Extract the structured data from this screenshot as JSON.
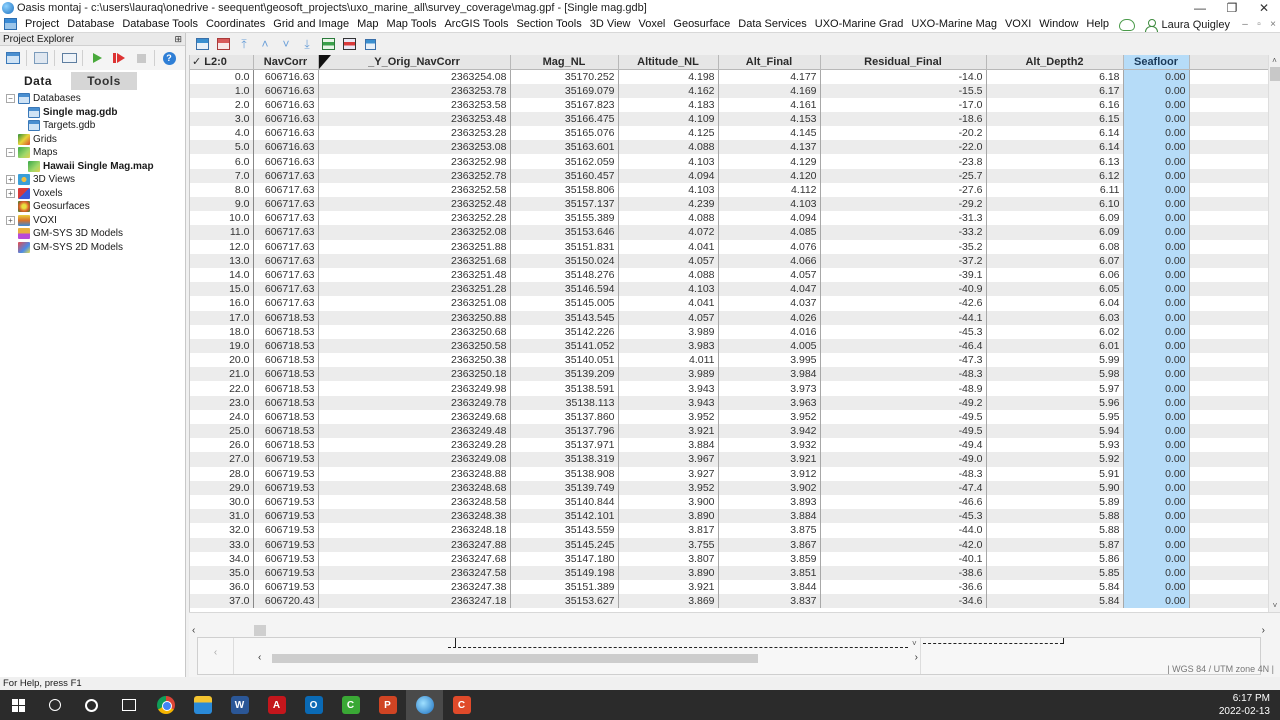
{
  "window": {
    "title": "Oasis montaj - c:\\users\\lauraq\\onedrive - seequent\\geosoft_projects\\uxo_marine_all\\survey_coverage\\mag.gpf - [Single mag.gdb]",
    "controls": {
      "minimize": "—",
      "restore": "❐",
      "close": "✕"
    }
  },
  "menubar": {
    "items": [
      "Project",
      "Database",
      "Database Tools",
      "Coordinates",
      "Grid and Image",
      "Map",
      "Map Tools",
      "ArcGIS Tools",
      "Section Tools",
      "3D View",
      "Voxel",
      "Geosurface",
      "Data Services",
      "UXO-Marine Grad",
      "UXO-Marine Mag",
      "VOXI",
      "Window",
      "Help"
    ],
    "user_name": "Laura Quigley",
    "mdi_controls": {
      "minimize": "–",
      "restore": "▫",
      "close": "×"
    }
  },
  "explorer": {
    "title": "Project Explorer",
    "pin": "⊞",
    "tabs": [
      {
        "label": "Data",
        "active": true
      },
      {
        "label": "Tools",
        "active": false
      }
    ],
    "tree": [
      {
        "label": "Databases",
        "expander": "−",
        "icon": "database-icon",
        "level": 0
      },
      {
        "label": "Single mag.gdb",
        "icon": "database-file-icon",
        "level": 1,
        "bold": true
      },
      {
        "label": "Targets.gdb",
        "icon": "database-file-icon",
        "level": 1
      },
      {
        "label": "Grids",
        "icon": "grid-icon",
        "level": 0
      },
      {
        "label": "Maps",
        "expander": "−",
        "icon": "map-icon",
        "level": 0
      },
      {
        "label": "Hawaii Single Mag.map",
        "icon": "map-file-icon",
        "level": 1,
        "bold": true
      },
      {
        "label": "3D Views",
        "expander": "+",
        "icon": "3d-view-icon",
        "level": 0
      },
      {
        "label": "Voxels",
        "expander": "+",
        "icon": "voxel-icon",
        "level": 0
      },
      {
        "label": "Geosurfaces",
        "icon": "geosurface-icon",
        "level": 0
      },
      {
        "label": "VOXI",
        "expander": "+",
        "icon": "voxi-icon",
        "level": 0
      },
      {
        "label": "GM-SYS 3D Models",
        "icon": "gmsys-3d-icon",
        "level": 0
      },
      {
        "label": "GM-SYS 2D Models",
        "icon": "gmsys-2d-icon",
        "level": 0
      }
    ]
  },
  "sheet": {
    "line_label": "✓ L2:0",
    "columns": [
      "NavCorr",
      "_Y_Orig_NavCorr",
      "Mag_NL",
      "Altitude_NL",
      "Alt_Final",
      "Residual_Final",
      "Alt_Depth2",
      "Seafloor"
    ],
    "selected_column": "Seafloor",
    "rows": [
      [
        "0.0",
        "606716.63",
        "2363254.08",
        "35170.252",
        "4.198",
        "4.177",
        "-14.0",
        "6.18",
        "0.00"
      ],
      [
        "1.0",
        "606716.63",
        "2363253.78",
        "35169.079",
        "4.162",
        "4.169",
        "-15.5",
        "6.17",
        "0.00"
      ],
      [
        "2.0",
        "606716.63",
        "2363253.58",
        "35167.823",
        "4.183",
        "4.161",
        "-17.0",
        "6.16",
        "0.00"
      ],
      [
        "3.0",
        "606716.63",
        "2363253.48",
        "35166.475",
        "4.109",
        "4.153",
        "-18.6",
        "6.15",
        "0.00"
      ],
      [
        "4.0",
        "606716.63",
        "2363253.28",
        "35165.076",
        "4.125",
        "4.145",
        "-20.2",
        "6.14",
        "0.00"
      ],
      [
        "5.0",
        "606716.63",
        "2363253.08",
        "35163.601",
        "4.088",
        "4.137",
        "-22.0",
        "6.14",
        "0.00"
      ],
      [
        "6.0",
        "606716.63",
        "2363252.98",
        "35162.059",
        "4.103",
        "4.129",
        "-23.8",
        "6.13",
        "0.00"
      ],
      [
        "7.0",
        "606717.63",
        "2363252.78",
        "35160.457",
        "4.094",
        "4.120",
        "-25.7",
        "6.12",
        "0.00"
      ],
      [
        "8.0",
        "606717.63",
        "2363252.58",
        "35158.806",
        "4.103",
        "4.112",
        "-27.6",
        "6.11",
        "0.00"
      ],
      [
        "9.0",
        "606717.63",
        "2363252.48",
        "35157.137",
        "4.239",
        "4.103",
        "-29.2",
        "6.10",
        "0.00"
      ],
      [
        "10.0",
        "606717.63",
        "2363252.28",
        "35155.389",
        "4.088",
        "4.094",
        "-31.3",
        "6.09",
        "0.00"
      ],
      [
        "11.0",
        "606717.63",
        "2363252.08",
        "35153.646",
        "4.072",
        "4.085",
        "-33.2",
        "6.09",
        "0.00"
      ],
      [
        "12.0",
        "606717.63",
        "2363251.88",
        "35151.831",
        "4.041",
        "4.076",
        "-35.2",
        "6.08",
        "0.00"
      ],
      [
        "13.0",
        "606717.63",
        "2363251.68",
        "35150.024",
        "4.057",
        "4.066",
        "-37.2",
        "6.07",
        "0.00"
      ],
      [
        "14.0",
        "606717.63",
        "2363251.48",
        "35148.276",
        "4.088",
        "4.057",
        "-39.1",
        "6.06",
        "0.00"
      ],
      [
        "15.0",
        "606717.63",
        "2363251.28",
        "35146.594",
        "4.103",
        "4.047",
        "-40.9",
        "6.05",
        "0.00"
      ],
      [
        "16.0",
        "606717.63",
        "2363251.08",
        "35145.005",
        "4.041",
        "4.037",
        "-42.6",
        "6.04",
        "0.00"
      ],
      [
        "17.0",
        "606718.53",
        "2363250.88",
        "35143.545",
        "4.057",
        "4.026",
        "-44.1",
        "6.03",
        "0.00"
      ],
      [
        "18.0",
        "606718.53",
        "2363250.68",
        "35142.226",
        "3.989",
        "4.016",
        "-45.3",
        "6.02",
        "0.00"
      ],
      [
        "19.0",
        "606718.53",
        "2363250.58",
        "35141.052",
        "3.983",
        "4.005",
        "-46.4",
        "6.01",
        "0.00"
      ],
      [
        "20.0",
        "606718.53",
        "2363250.38",
        "35140.051",
        "4.011",
        "3.995",
        "-47.3",
        "5.99",
        "0.00"
      ],
      [
        "21.0",
        "606718.53",
        "2363250.18",
        "35139.209",
        "3.989",
        "3.984",
        "-48.3",
        "5.98",
        "0.00"
      ],
      [
        "22.0",
        "606718.53",
        "2363249.98",
        "35138.591",
        "3.943",
        "3.973",
        "-48.9",
        "5.97",
        "0.00"
      ],
      [
        "23.0",
        "606718.53",
        "2363249.78",
        "35138.113",
        "3.943",
        "3.963",
        "-49.2",
        "5.96",
        "0.00"
      ],
      [
        "24.0",
        "606718.53",
        "2363249.68",
        "35137.860",
        "3.952",
        "3.952",
        "-49.5",
        "5.95",
        "0.00"
      ],
      [
        "25.0",
        "606718.53",
        "2363249.48",
        "35137.796",
        "3.921",
        "3.942",
        "-49.5",
        "5.94",
        "0.00"
      ],
      [
        "26.0",
        "606718.53",
        "2363249.28",
        "35137.971",
        "3.884",
        "3.932",
        "-49.4",
        "5.93",
        "0.00"
      ],
      [
        "27.0",
        "606719.53",
        "2363249.08",
        "35138.319",
        "3.967",
        "3.921",
        "-49.0",
        "5.92",
        "0.00"
      ],
      [
        "28.0",
        "606719.53",
        "2363248.88",
        "35138.908",
        "3.927",
        "3.912",
        "-48.3",
        "5.91",
        "0.00"
      ],
      [
        "29.0",
        "606719.53",
        "2363248.68",
        "35139.749",
        "3.952",
        "3.902",
        "-47.4",
        "5.90",
        "0.00"
      ],
      [
        "30.0",
        "606719.53",
        "2363248.58",
        "35140.844",
        "3.900",
        "3.893",
        "-46.6",
        "5.89",
        "0.00"
      ],
      [
        "31.0",
        "606719.53",
        "2363248.38",
        "35142.101",
        "3.890",
        "3.884",
        "-45.3",
        "5.88",
        "0.00"
      ],
      [
        "32.0",
        "606719.53",
        "2363248.18",
        "35143.559",
        "3.817",
        "3.875",
        "-44.0",
        "5.88",
        "0.00"
      ],
      [
        "33.0",
        "606719.53",
        "2363247.88",
        "35145.245",
        "3.755",
        "3.867",
        "-42.0",
        "5.87",
        "0.00"
      ],
      [
        "34.0",
        "606719.53",
        "2363247.68",
        "35147.180",
        "3.807",
        "3.859",
        "-40.1",
        "5.86",
        "0.00"
      ],
      [
        "35.0",
        "606719.53",
        "2363247.58",
        "35149.198",
        "3.890",
        "3.851",
        "-38.6",
        "5.85",
        "0.00"
      ],
      [
        "36.0",
        "606719.53",
        "2363247.38",
        "35151.389",
        "3.921",
        "3.844",
        "-36.6",
        "5.84",
        "0.00"
      ],
      [
        "37.0",
        "606720.43",
        "2363247.18",
        "35153.627",
        "3.869",
        "3.837",
        "-34.6",
        "5.84",
        "0.00"
      ]
    ]
  },
  "scroll": {
    "left": "‹",
    "right": "›",
    "up": "˄",
    "down": "˅"
  },
  "profile": {
    "coord_system": "| WGS 84 / UTM zone 4N |"
  },
  "statusbar": {
    "text": "For Help, press F1"
  },
  "taskbar": {
    "time": "6:17 PM",
    "date": "2022-02-13",
    "apps": [
      {
        "name": "chrome",
        "label": ""
      },
      {
        "name": "file-explorer",
        "label": ""
      },
      {
        "name": "word",
        "label": "W",
        "color": "#2b5797"
      },
      {
        "name": "acrobat",
        "label": "A",
        "color": "#c4161c"
      },
      {
        "name": "outlook",
        "label": "O",
        "color": "#0a6ab5"
      },
      {
        "name": "camtasia",
        "label": "C",
        "color": "#3aa835"
      },
      {
        "name": "powerpoint",
        "label": "P",
        "color": "#d04423"
      },
      {
        "name": "oasis-montaj",
        "label": "",
        "color": "#2b7fd0",
        "active": true
      },
      {
        "name": "camtasia-recorder",
        "label": "C",
        "color": "#e04a2a"
      }
    ]
  }
}
